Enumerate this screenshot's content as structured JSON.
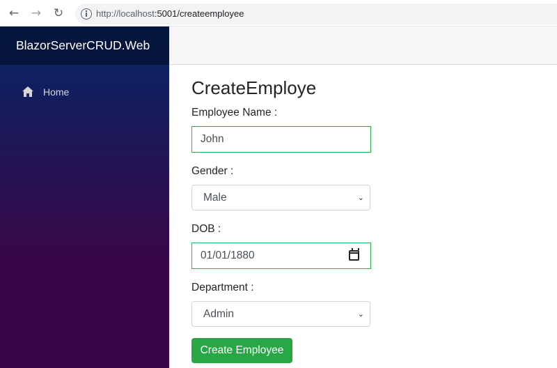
{
  "browser": {
    "url_scheme_host": "http://localhost",
    "url_rest": ":5001/createemployee",
    "icons": [
      "back-arrow-icon",
      "forward-arrow-icon",
      "reload-icon",
      "info-icon"
    ]
  },
  "sidebar": {
    "brand": "BlazorServerCRUD.Web",
    "items": [
      {
        "label": "Home",
        "icon": "home-icon"
      }
    ]
  },
  "form": {
    "title": "CreateEmploye",
    "name_label": "Employee Name :",
    "name_value": "John",
    "gender_label": "Gender :",
    "gender_value": "Male",
    "dob_label": "DOB :",
    "dob_value": "01/01/1880",
    "department_label": "Department :",
    "department_value": "Admin",
    "submit_label": "Create Employee"
  },
  "colors": {
    "sidebar_top": "#052767",
    "sidebar_bottom": "#3a0647",
    "valid_border": "#26b050",
    "button": "#28a745"
  }
}
